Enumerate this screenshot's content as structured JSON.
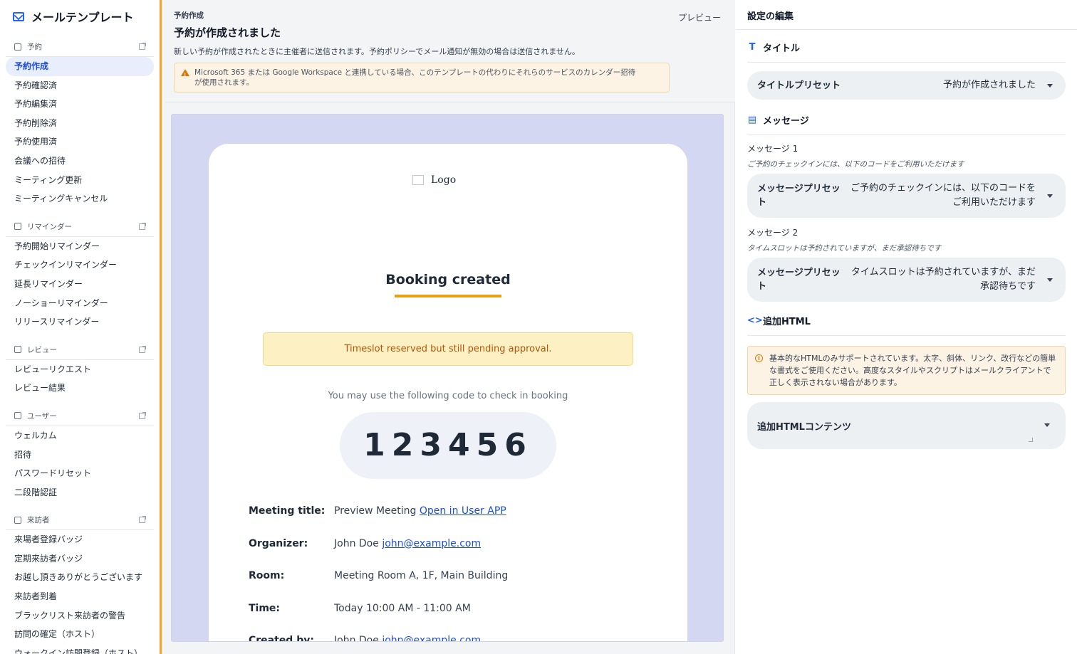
{
  "app": {
    "title": "メールテンプレート"
  },
  "sidebar": {
    "sections": [
      {
        "label": "予約",
        "items": [
          "予約作成",
          "予約確認済",
          "予約編集済",
          "予約削除済",
          "予約使用済",
          "会議への招待",
          "ミーティング更新",
          "ミーティングキャンセル"
        ]
      },
      {
        "label": "リマインダー",
        "items": [
          "予約開始リマインダー",
          "チェックインリマインダー",
          "延長リマインダー",
          "ノーショーリマインダー",
          "リリースリマインダー"
        ]
      },
      {
        "label": "レビュー",
        "items": [
          "レビューリクエスト",
          "レビュー結果"
        ]
      },
      {
        "label": "ユーザー",
        "items": [
          "ウェルカム",
          "招待",
          "パスワードリセット",
          "二段階認証"
        ]
      },
      {
        "label": "来訪者",
        "items": [
          "来場者登録バッジ",
          "定期来訪者バッジ",
          "お越し頂きありがとうございます",
          "来訪者到着",
          "ブラックリスト来訪者の警告",
          "訪問の確定（ホスト）",
          "ウォークイン訪問登録（ホスト）"
        ]
      }
    ]
  },
  "header": {
    "breadcrumb": "予約作成",
    "title": "予約が作成されました",
    "description": "新しい予約が作成されたときに主催者に送信されます。予約ポリシーでメール通知が無効の場合は送信されません。",
    "warning_line1": "Microsoft 365 または Google Workspace と連携している場合、このテンプレートの代わりにそれらのサービスのカレンダー招待",
    "warning_line2": "が使用されます。",
    "preview_label": "プレビュー"
  },
  "email": {
    "logo_alt": "Logo",
    "heading": "Booking created",
    "pending_notice": "Timeslot reserved but still pending approval.",
    "checkin_text": "You may use the following code to check in booking",
    "code": "123456",
    "details": {
      "meeting_title_label": "Meeting title:",
      "meeting_title_value": "Preview Meeting",
      "meeting_title_link": "Open in User APP",
      "organizer_label": "Organizer:",
      "organizer_value": "John Doe",
      "organizer_email": "john@example.com",
      "room_label": "Room:",
      "room_value": "Meeting Room A, 1F, Main Building",
      "time_label": "Time:",
      "time_value": "Today 10:00 AM - 11:00 AM",
      "created_by_label": "Created by:",
      "created_by_value": "John Doe",
      "created_by_email": "john@example.com"
    }
  },
  "settings": {
    "panel_title": "設定の編集",
    "title_section": "タイトル",
    "title_preset_label": "タイトルプリセット",
    "title_preset_value": "予約が作成されました",
    "message_section": "メッセージ",
    "message1_label": "メッセージ 1",
    "message1_help": "ご予約のチェックインには、以下のコードをご利用いただけます",
    "message1_preset_label": "メッセージプリセット",
    "message1_preset_value": "ご予約のチェックインには、以下のコードをご利用いただけます",
    "message2_label": "メッセージ 2",
    "message2_help": "タイムスロットは予約されていますが、まだ承認待ちです",
    "message2_preset_label": "メッセージプリセット",
    "message2_preset_value": "タイムスロットは予約されていますが、まだ承認待ちです",
    "html_section": "追加HTML",
    "html_info": "基本的なHTMLのみサポートされています。太字、斜体、リンク、改行などの簡単な書式をご使用ください。高度なスタイルやスクリプトはメールクライアントで正しく表示されない場合があります。",
    "html_content_label": "追加HTMLコンテンツ"
  },
  "colors": {
    "accent": "#2563eb",
    "highlight": "#e6a018",
    "canvas": "#d4d7f2"
  }
}
